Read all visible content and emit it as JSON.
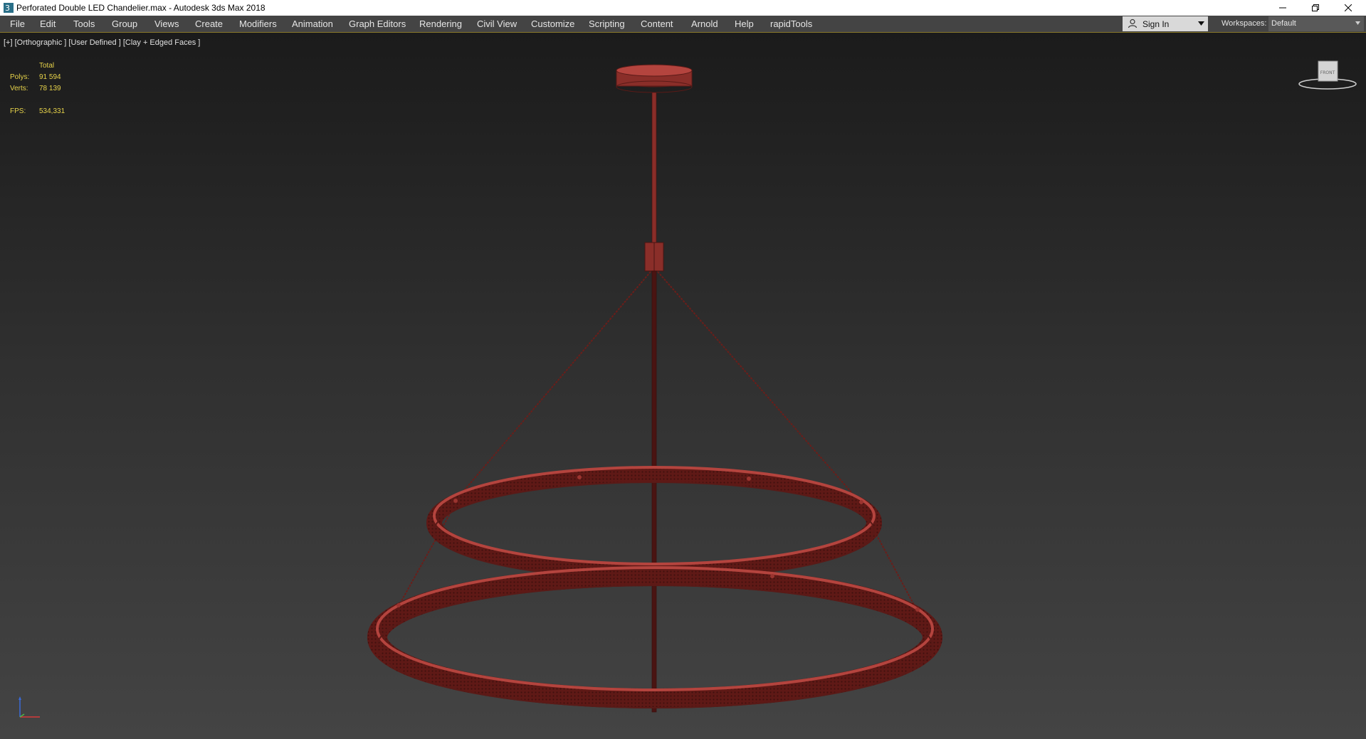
{
  "window": {
    "title": "Perforated Double LED Chandelier.max - Autodesk 3ds Max 2018",
    "icon": "3ds-max-app-icon",
    "controls": [
      "minimize-icon",
      "restore-icon",
      "close-icon"
    ]
  },
  "menubar": {
    "items": [
      {
        "label": "File"
      },
      {
        "label": "Edit"
      },
      {
        "label": "Tools"
      },
      {
        "label": "Group"
      },
      {
        "label": "Views"
      },
      {
        "label": "Create"
      },
      {
        "label": "Modifiers"
      },
      {
        "label": "Animation"
      },
      {
        "label": "Graph Editors"
      },
      {
        "label": "Rendering"
      },
      {
        "label": "Civil View"
      },
      {
        "label": "Customize"
      },
      {
        "label": "Scripting"
      },
      {
        "label": "Content"
      },
      {
        "label": "Arnold"
      },
      {
        "label": "Help"
      },
      {
        "label": "rapidTools"
      }
    ],
    "signin": {
      "label": "Sign In",
      "icon": "user-icon"
    },
    "workspaces": {
      "label": "Workspaces:",
      "value": "Default"
    }
  },
  "viewport": {
    "label": "[+] [Orthographic ] [User Defined ] [Clay + Edged Faces ]",
    "stats": {
      "header": "Total",
      "polys_label": "Polys:",
      "polys": "91 594",
      "verts_label": "Verts:",
      "verts": "78 139",
      "fps_label": "FPS:",
      "fps": "534,331"
    },
    "viewcube": {
      "face_label": "FRONT"
    },
    "colors": {
      "wireframe": "#8a2a26",
      "stats_text": "#e7d34a"
    }
  }
}
